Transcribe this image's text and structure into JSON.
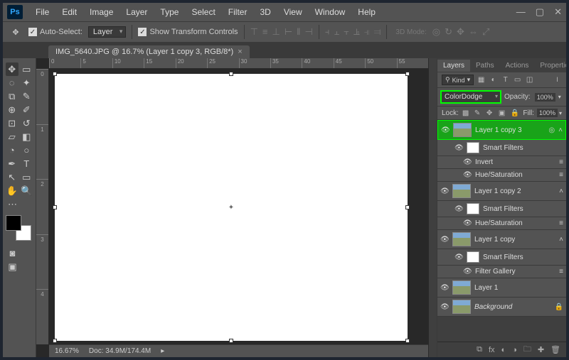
{
  "logo": "Ps",
  "menu": [
    "File",
    "Edit",
    "Image",
    "Layer",
    "Type",
    "Select",
    "Filter",
    "3D",
    "View",
    "Window",
    "Help"
  ],
  "options": {
    "auto_select": "Auto-Select:",
    "auto_select_target": "Layer",
    "show_transform": "Show Transform Controls",
    "mode3d": "3D Mode:"
  },
  "doc_tab": {
    "title": "IMG_5640.JPG @ 16.7% (Layer 1 copy 3, RGB/8*)"
  },
  "ruler_h": [
    "0",
    "5",
    "10",
    "15",
    "20",
    "25",
    "30",
    "35",
    "40",
    "45",
    "50",
    "55"
  ],
  "ruler_v": [
    "0",
    "1",
    "2",
    "3",
    "4"
  ],
  "status": {
    "zoom": "16.67%",
    "doc": "Doc: 34.9M/174.4M"
  },
  "panels": {
    "tabs": [
      "Layers",
      "Paths",
      "Actions",
      "Properties"
    ],
    "kind_label": "Kind",
    "blend_mode": "ColorDodge",
    "opacity_label": "Opacity:",
    "opacity_value": "100%",
    "lock_label": "Lock:",
    "fill_label": "Fill:",
    "fill_value": "100%",
    "layers": [
      {
        "name": "Layer 1 copy 3",
        "sel": true
      },
      {
        "name": "Smart Filters",
        "sub": true,
        "white": true
      },
      {
        "name": "Invert",
        "sub2": true
      },
      {
        "name": "Hue/Saturation",
        "sub2": true
      },
      {
        "name": "Layer 1 copy 2"
      },
      {
        "name": "Smart Filters",
        "sub": true,
        "white": true
      },
      {
        "name": "Hue/Saturation",
        "sub2": true
      },
      {
        "name": "Layer 1 copy"
      },
      {
        "name": "Smart Filters",
        "sub": true,
        "white": true
      },
      {
        "name": "Filter Gallery",
        "sub2": true
      },
      {
        "name": "Layer 1"
      },
      {
        "name": "Background",
        "italic": true,
        "lock": true
      }
    ]
  }
}
